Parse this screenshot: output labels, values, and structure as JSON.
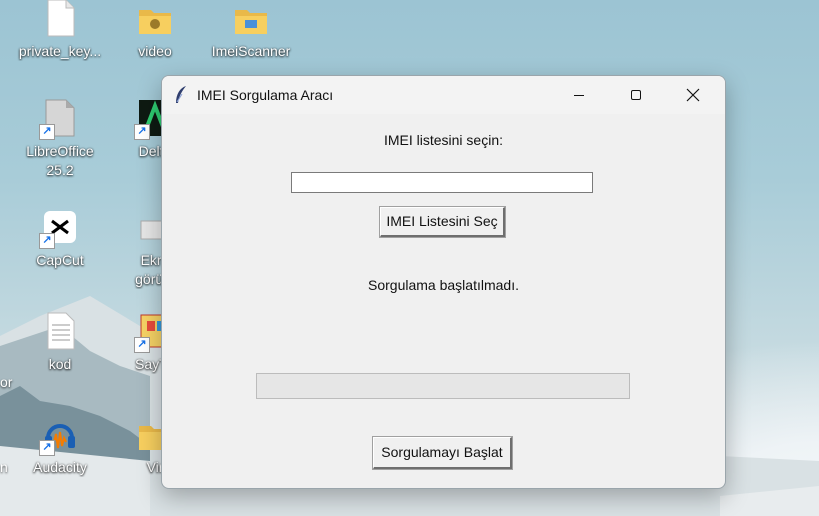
{
  "desktop": {
    "icons": [
      {
        "label": "private_key...",
        "type": "file"
      },
      {
        "label": "video",
        "type": "folder"
      },
      {
        "label": "ImeiScanner",
        "type": "folder"
      },
      {
        "label": "LibreOffice 25.2",
        "type": "shortcut"
      },
      {
        "label": "Delta",
        "type": "shortcut"
      },
      {
        "label": "CapCut",
        "type": "shortcut"
      },
      {
        "label": "Ekra",
        "label2": "görünt",
        "type": "shortcut"
      },
      {
        "label": "kod",
        "type": "file"
      },
      {
        "label": "SayTu",
        "type": "shortcut"
      },
      {
        "label": "Audacity",
        "type": "shortcut"
      },
      {
        "label": "Vir",
        "type": "folder"
      }
    ],
    "edge_labels": [
      "or",
      "n"
    ]
  },
  "window": {
    "title": "IMEI Sorgulama Aracı",
    "controls": {
      "minimize": "minimize-icon",
      "maximize": "maximize-icon",
      "close": "close-icon"
    },
    "file_prompt": "IMEI listesini seçin:",
    "file_path_value": "",
    "select_button": "IMEI Listesini Seç",
    "status_text": "Sorgulama başlatılmadı.",
    "progress": 0,
    "start_button": "Sorgulamayı Başlat"
  },
  "colors": {
    "window_bg": "#f0f0f0",
    "progress_fill": "#06b025"
  }
}
